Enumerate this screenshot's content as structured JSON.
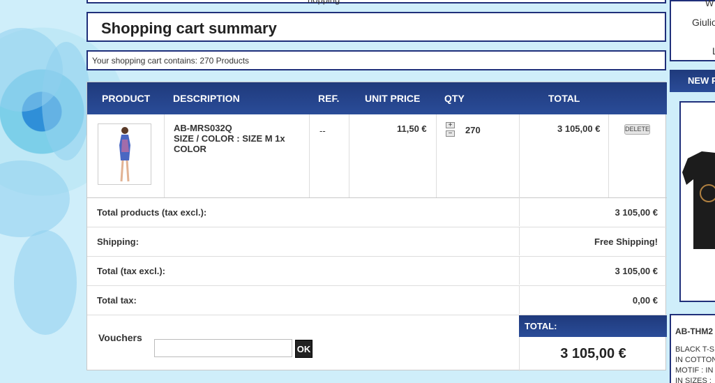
{
  "top_strip": {
    "text": "hopping"
  },
  "title": "Shopping cart summary",
  "summary": "Your shopping cart contains: 270 Products",
  "table": {
    "headers": [
      "PRODUCT",
      "DESCRIPTION",
      "REF.",
      "UNIT PRICE",
      "QTY",
      "TOTAL"
    ],
    "item": {
      "code": "AB-MRS032Q",
      "attributes": "SIZE / COLOR : SIZE M 1x COLOR",
      "ref": "--",
      "unit_price": "11,50 €",
      "qty": "270",
      "total": "3 105,00 €",
      "delete_label": "DELETE"
    }
  },
  "totals": [
    {
      "label": "Total products (tax excl.):",
      "value": "3 105,00 €"
    },
    {
      "label": "Shipping:",
      "value": "Free Shipping!"
    },
    {
      "label": "Total (tax excl.):",
      "value": "3 105,00 €"
    },
    {
      "label": "Total tax:",
      "value": "0,00 €"
    }
  ],
  "vouchers": {
    "label": "Vouchers",
    "value": "",
    "ok_label": "OK"
  },
  "grand_total": {
    "label": "TOTAL:",
    "value": "3 105,00 €"
  },
  "sidebar": {
    "box1_line1": "W",
    "box1_line2": "Giulio",
    "box1_line3": "L",
    "new_heading": "NEW P",
    "product_title": "AB-THM2",
    "product_desc_1": "BLACK T-S",
    "product_desc_2": "IN COTTON",
    "product_desc_3": "MOTIF : IN",
    "product_desc_4": "IN SIZES :"
  },
  "colors": {
    "header_blue": "#1f3a7c",
    "border_blue": "#1f2f7a"
  }
}
